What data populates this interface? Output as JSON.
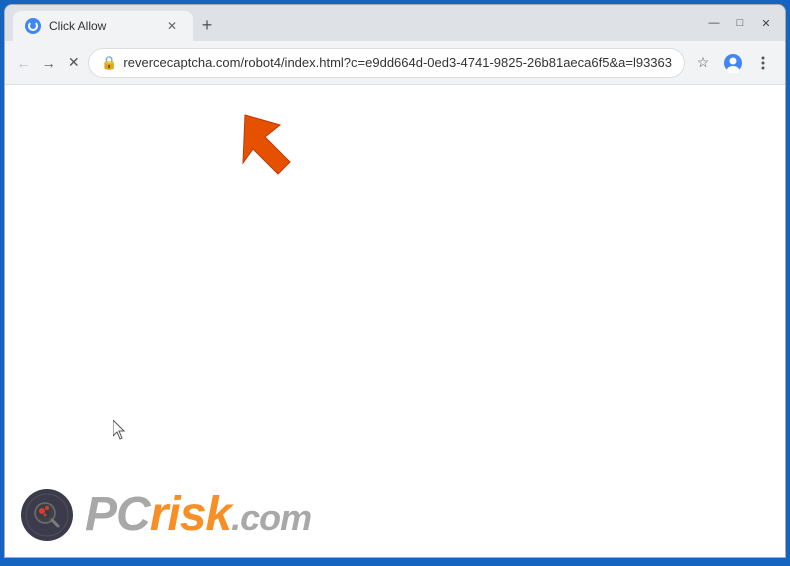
{
  "window": {
    "title": "Click Allow",
    "url": "revercecaptcha.com/robot4/index.html?c=e9dd664d-0ed3-4741-9825-26b81aeca6f5&a=l93363",
    "url_display": "revercecaptcha.com/robot4/index.html?c=e9dd664d-0ed3-4741-9825-26b81aeca6f5&a=l93363"
  },
  "tabs": [
    {
      "label": "Click Allow",
      "active": true
    }
  ],
  "toolbar": {
    "new_tab_label": "+",
    "back_label": "←",
    "forward_label": "→",
    "reload_label": "✕",
    "bookmark_label": "☆",
    "profile_label": "👤",
    "menu_label": "⋮"
  },
  "controls": {
    "minimize": "—",
    "maximize": "□",
    "close": "✕"
  },
  "watermark": {
    "pc_text": "PC",
    "risk_text": "risk",
    "dotcom_text": ".com"
  }
}
